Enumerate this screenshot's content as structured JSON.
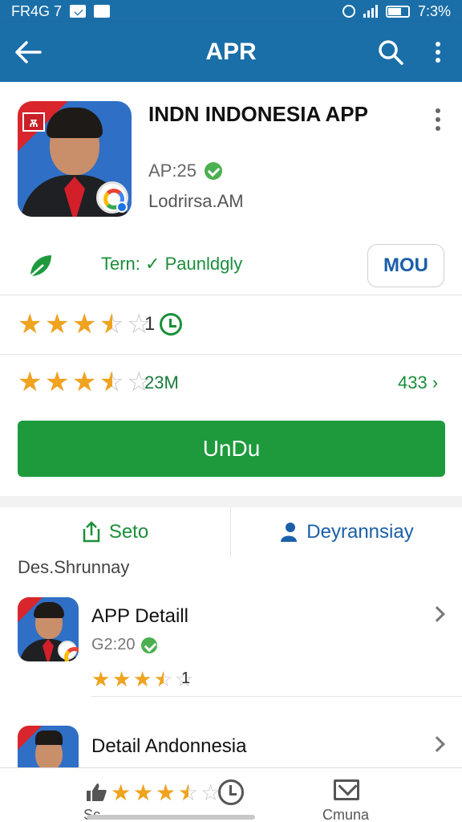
{
  "status_bar": {
    "left_text": "FR4G 7",
    "right_text": "7:3%"
  },
  "app_bar": {
    "title": "APR",
    "back_icon": "arrow-left-icon",
    "search_icon": "search-icon",
    "more_icon": "more-vert-icon"
  },
  "app": {
    "title": "INDN INDONESIA APP",
    "version": "AP:25",
    "developer": "Lodrirsa.AM",
    "icon_badge": "Ѫ"
  },
  "promo": {
    "text": "Tern: ✓ Paunldgly",
    "button": "MOU"
  },
  "rating1": {
    "stars": 3.5,
    "count": "1"
  },
  "rating2": {
    "stars": 3.5,
    "count": "23M",
    "right": "433 ›"
  },
  "download_button": "UnDu",
  "tabs": [
    {
      "label": "Seto",
      "icon": "share-icon"
    },
    {
      "label": "Deyrannsiay",
      "icon": "user-icon"
    }
  ],
  "section_label": "Des.Shrunnay",
  "list": [
    {
      "title": "APP Detaill",
      "subtitle": "G2:20",
      "stars": 3.5,
      "count": "1"
    },
    {
      "title": "Detail Andonnesia",
      "subtitle": ""
    }
  ],
  "bottom_nav": [
    {
      "label": "Sc",
      "icon": "thumb-up-icon"
    },
    {
      "label": "",
      "icon": "clock-icon"
    },
    {
      "label": "Cmuna",
      "icon": "mail-icon"
    }
  ],
  "colors": {
    "primary": "#1b6fa8",
    "green": "#1e9a3d",
    "star": "#f0a31f"
  }
}
